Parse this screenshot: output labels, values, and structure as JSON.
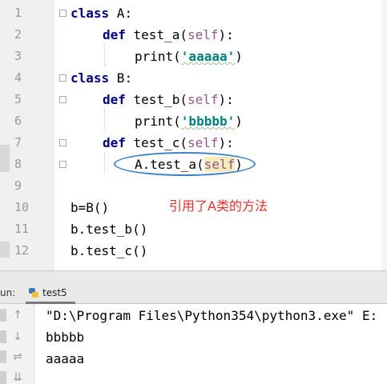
{
  "editor": {
    "line_numbers": [
      "1",
      "2",
      "3",
      "4",
      "5",
      "6",
      "7",
      "8",
      "9",
      "10",
      "11",
      "12"
    ],
    "lines": [
      {
        "kw": "class",
        "rest": " A:"
      },
      {
        "kw": "def",
        "fn": " test_a(",
        "self": "self",
        "tail": "):"
      },
      {
        "fn": "print(",
        "str": "'aaaaa'",
        "tail": ")"
      },
      {
        "kw": "class",
        "rest": " B:"
      },
      {
        "kw": "def",
        "fn": " test_b(",
        "self": "self",
        "tail": "):"
      },
      {
        "fn": "print(",
        "str": "'bbbbb'",
        "tail": ")"
      },
      {
        "kw": "def",
        "fn": " test_c(",
        "self": "self",
        "tail": "):"
      },
      {
        "fn": "A.test_a(",
        "self": "self",
        "tail": ")"
      },
      {
        "text": ""
      },
      {
        "text": "b=B()"
      },
      {
        "text": "b.test_b()"
      },
      {
        "text": "b.test_c()"
      }
    ],
    "annotation": "引用了A类的方法",
    "ellipse_color": "#3d82c8",
    "annotation_color": "#e0312a"
  },
  "run_panel": {
    "label": "un:",
    "tab_label": "test5",
    "tab_icon": "python-file-icon",
    "toolbar": {
      "up": "↑",
      "down": "↓",
      "wrap": "⇌",
      "scroll_end": "⇊"
    },
    "output": [
      "\"D:\\Program Files\\Python354\\python3.exe\" E:",
      "bbbbb",
      "aaaaa"
    ]
  }
}
